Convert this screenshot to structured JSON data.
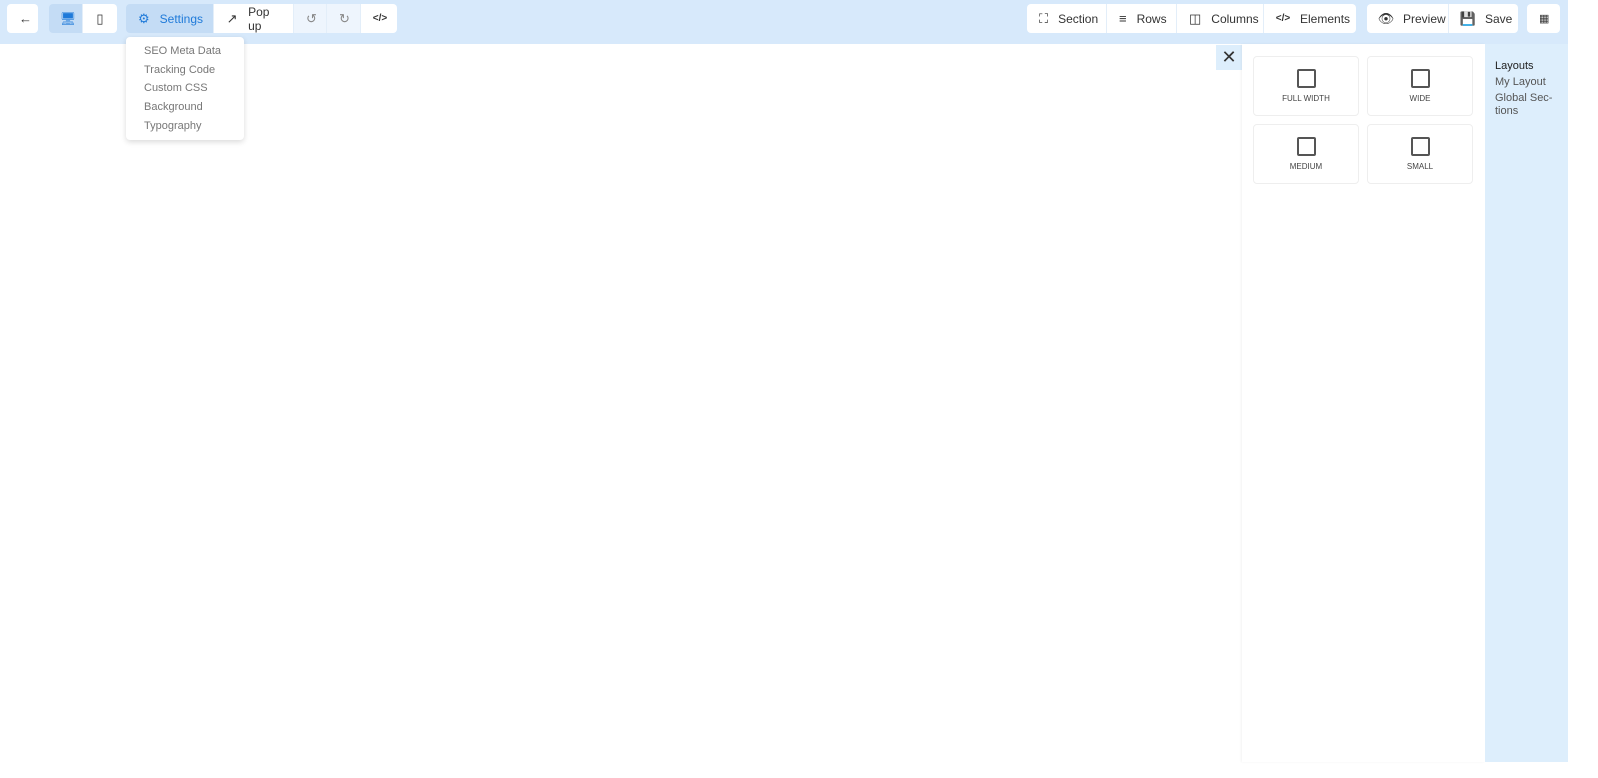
{
  "toolbar": {
    "back": "back",
    "settings": "Settings",
    "popup": "Pop up",
    "section": "Section",
    "rows": "Rows",
    "columns": "Columns",
    "elements": "Elements",
    "preview": "Preview",
    "save": "Save"
  },
  "settings_menu": [
    "SEO Meta Data",
    "Tracking Code",
    "Custom CSS",
    "Background",
    "Typography"
  ],
  "layouts": [
    "FULL WIDTH",
    "WIDE",
    "MEDIUM",
    "SMALL"
  ],
  "sidebar": [
    "Layouts",
    "My Layout",
    "Global Sec-tions"
  ],
  "colors": {
    "accent": "#1f7ad9",
    "topbar": "#d7e9fb"
  }
}
